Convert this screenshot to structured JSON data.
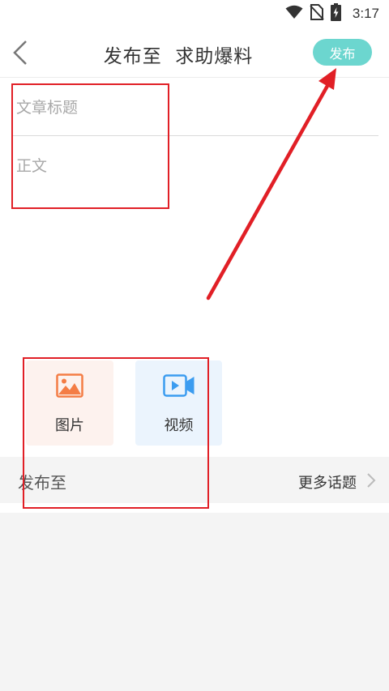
{
  "status_bar": {
    "time": "3:17",
    "icons": [
      "wifi-icon",
      "no-sim-icon",
      "battery-charging-icon"
    ]
  },
  "header": {
    "back_icon": "chevron-left-icon",
    "title": "发布至  求助爆料",
    "publish_label": "发布"
  },
  "editor": {
    "title_placeholder": "文章标题",
    "body_placeholder": "正文"
  },
  "media": {
    "image_label": "图片",
    "image_icon": "image-icon",
    "video_label": "视频",
    "video_icon": "video-camera-icon"
  },
  "topic_row": {
    "label": "发布至",
    "more_label": "更多话题",
    "chevron_icon": "chevron-right-icon"
  },
  "colors": {
    "accent": "#6cd6cf",
    "image_accent": "#f47d45",
    "video_accent": "#3b9cf0",
    "annotation": "#e11f26"
  }
}
